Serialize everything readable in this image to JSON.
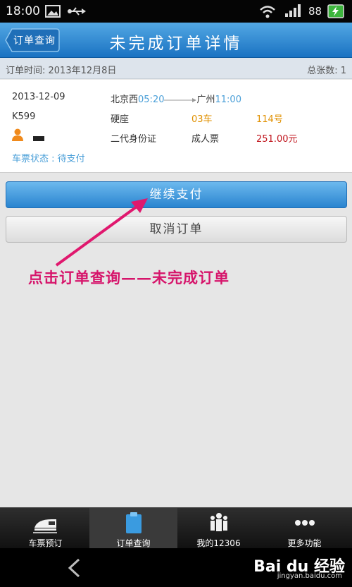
{
  "status_bar": {
    "time": "18:00",
    "battery": "88"
  },
  "header": {
    "back_label": "订单查询",
    "title": "未完成订单详情"
  },
  "info_bar": {
    "order_time": "订单时间: 2013年12月8日",
    "total_count": "总张数: 1"
  },
  "order": {
    "date": "2013-12-09",
    "from_station": "北京西",
    "depart_time": "05:20",
    "to_station": "广州",
    "arrive_time": "11:00",
    "train_no": "K599",
    "seat_type": "硬座",
    "coach": "03车",
    "seat_no": "114号",
    "id_type": "二代身份证",
    "ticket_type": "成人票",
    "price": "251.00元",
    "status": "车票状态 : 待支付"
  },
  "actions": {
    "pay_label": "继续支付",
    "cancel_label": "取消订单"
  },
  "annotation": {
    "text": "点击订单查询——未完成订单"
  },
  "nav": {
    "items": [
      {
        "label": "车票预订",
        "icon": "train-icon"
      },
      {
        "label": "订单查询",
        "icon": "clipboard-icon"
      },
      {
        "label": "我的12306",
        "icon": "people-icon"
      },
      {
        "label": "更多功能",
        "icon": "more-icon"
      }
    ],
    "active_index": 1
  },
  "watermark": {
    "text": "Bai du 经验",
    "sub": "jingyan.baidu.com"
  },
  "colors": {
    "accent": "#2a84cf",
    "annotation": "#d6156b",
    "price": "#c0141c",
    "highlight": "#e09000"
  }
}
